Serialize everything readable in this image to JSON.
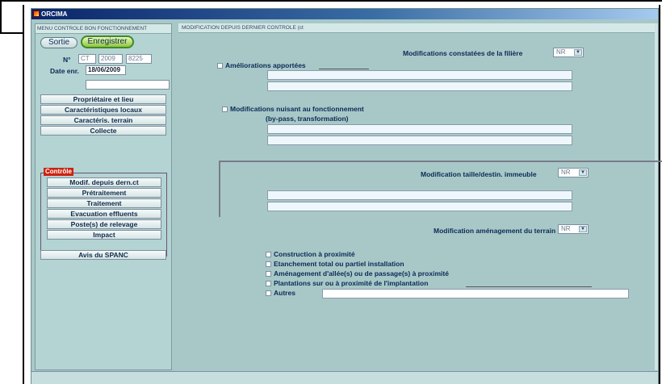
{
  "window": {
    "title": "ORCIMA"
  },
  "left": {
    "header": "MENU CONTROLE BON FONCTIONNEMENT",
    "sortie_label": "Sortie",
    "enregistrer_label": "Enregistrer",
    "num_label": "N°",
    "num_prefix": "CT",
    "num_year": "2009",
    "num_id": "8225",
    "date_label": "Date enr.",
    "date_value": "18/06/2009",
    "extra_field": "",
    "nav": [
      "Propriétaire et lieu",
      "Caractéristiques locaux",
      "Caractéris. terrain",
      "Collecte"
    ],
    "group_label": "Contrôle",
    "group_items": [
      "Modif. depuis dern.ct",
      "Prétraitement",
      "Traitement",
      "Evacuation effluents",
      "Poste(s) de relevage",
      "Impact"
    ],
    "avis": "Avis du SPANC"
  },
  "main": {
    "header": "MODIFICATION DEPUIS DERNIER CONTROLE (ct",
    "filiere_label": "Modifications constatées de la filière",
    "filiere_value": "NR",
    "ameliorations_label": "Améliorations apportées",
    "nuisant_label": "Modifications nuisant au fonctionnement",
    "nuisant_sub": "(by-pass, transformation)",
    "taille_label": "Modification taille/destin. immeuble",
    "taille_value": "NR",
    "amenagement_label": "Modification aménagement du terrain",
    "amenagement_value": "NR",
    "checks": [
      "Construction à proximité",
      "Etanchement total ou partiel installation",
      "Aménagement d'allée(s) ou de passage(s) à proximité",
      "Plantations sur ou à proximité de l'implantation",
      "Autres"
    ]
  },
  "icons": {
    "dropdown": "chevron-down-icon",
    "app": "app-logo-icon"
  }
}
